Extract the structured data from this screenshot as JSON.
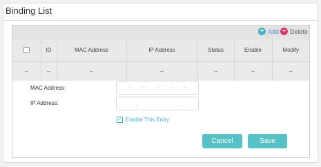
{
  "panel": {
    "title": "Binding List"
  },
  "toolbar": {
    "add_label": "Add",
    "delete_label": "Delete",
    "add_icon": "plus-circle-icon",
    "delete_icon": "minus-circle-icon"
  },
  "table": {
    "columns": [
      "",
      "ID",
      "MAC Address",
      "IP Address",
      "Status",
      "Enable",
      "Modify"
    ],
    "rows": [
      [
        "--",
        "--",
        "--",
        "--",
        "--",
        "--",
        "--"
      ]
    ]
  },
  "form": {
    "mac_label": "MAC Address:",
    "ip_label": "IP Address:",
    "enable_label": "Enable This Entry",
    "enable_checked": true,
    "cancel_label": "Cancel",
    "save_label": "Save"
  },
  "colors": {
    "accent": "#56c2c6",
    "add": "#3fb4c9",
    "delete": "#d9386d",
    "link": "#5a8fd0"
  }
}
